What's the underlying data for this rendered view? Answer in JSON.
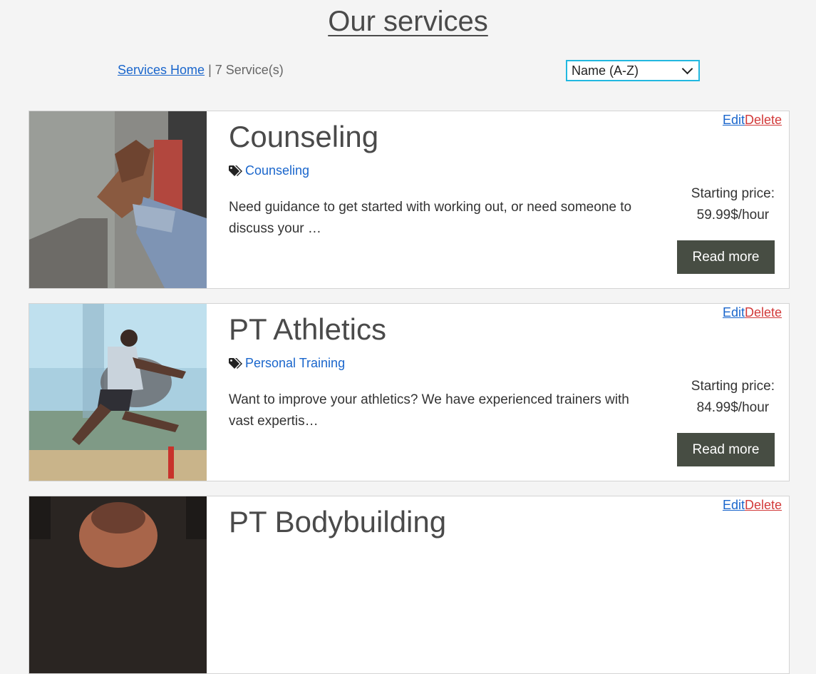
{
  "page": {
    "title": "Our services"
  },
  "toolbar": {
    "home_link": "Services Home",
    "separator": "|",
    "count_text": "7 Service(s)",
    "sort_value": "Name (A-Z)"
  },
  "services": [
    {
      "title": "Counseling",
      "category": "Counseling",
      "description": "Need guidance to get started with working out, or need someone to discuss your …",
      "price_label": "Starting price:",
      "price_value": "59.99$/hour",
      "read_more": "Read more",
      "edit": "Edit",
      "delete": "Delete"
    },
    {
      "title": "PT Athletics",
      "category": "Personal Training",
      "description": "Want to improve your athletics? We have experienced trainers with vast expertis…",
      "price_label": "Starting price:",
      "price_value": "84.99$/hour",
      "read_more": "Read more",
      "edit": "Edit",
      "delete": "Delete"
    },
    {
      "title": "PT Bodybuilding",
      "edit": "Edit",
      "delete": "Delete"
    }
  ],
  "colors": {
    "accent_link": "#1a66cc",
    "delete_link": "#d23a3a",
    "button_bg": "#474d43",
    "select_border": "#22b8e0"
  }
}
